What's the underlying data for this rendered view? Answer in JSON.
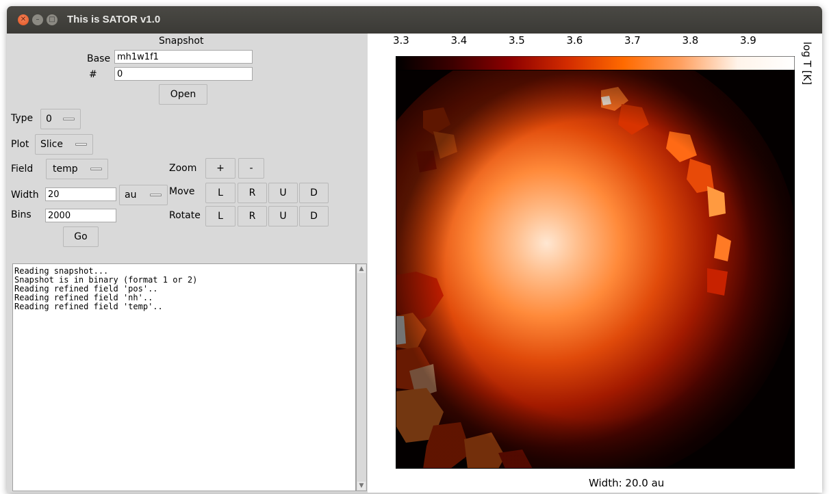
{
  "window": {
    "title": "This is SATOR v1.0"
  },
  "snapshot": {
    "heading": "Snapshot",
    "base_label": "Base",
    "base_value": "mh1w1f1",
    "num_label": "#",
    "num_value": "0",
    "open_label": "Open"
  },
  "controls": {
    "type_label": "Type",
    "type_value": "0",
    "plot_label": "Plot",
    "plot_value": "Slice",
    "field_label": "Field",
    "field_value": "temp",
    "width_label": "Width",
    "width_value": "20",
    "unit_value": "au",
    "bins_label": "Bins",
    "bins_value": "2000",
    "go_label": "Go",
    "zoom_label": "Zoom",
    "zoom_in": "+",
    "zoom_out": "-",
    "move_label": "Move",
    "rotate_label": "Rotate",
    "dir_l": "L",
    "dir_r": "R",
    "dir_u": "U",
    "dir_d": "D"
  },
  "log": {
    "lines": [
      "Reading snapshot...",
      "Snapshot is in binary (format 1 or 2)",
      "Reading refined field 'pos'..",
      "Reading refined field 'nh'..",
      "Reading refined field 'temp'.."
    ]
  },
  "plot": {
    "colorbar_label": "log T [K]",
    "colorbar_ticks": [
      "3.3",
      "3.4",
      "3.5",
      "3.6",
      "3.7",
      "3.8",
      "3.9"
    ],
    "colormap": [
      "#000000",
      "#3d0000",
      "#8c0000",
      "#d22b00",
      "#ff6a00",
      "#ffa060",
      "#fff4ea",
      "#ffffff"
    ],
    "caption": "Width: 20.0 au"
  }
}
